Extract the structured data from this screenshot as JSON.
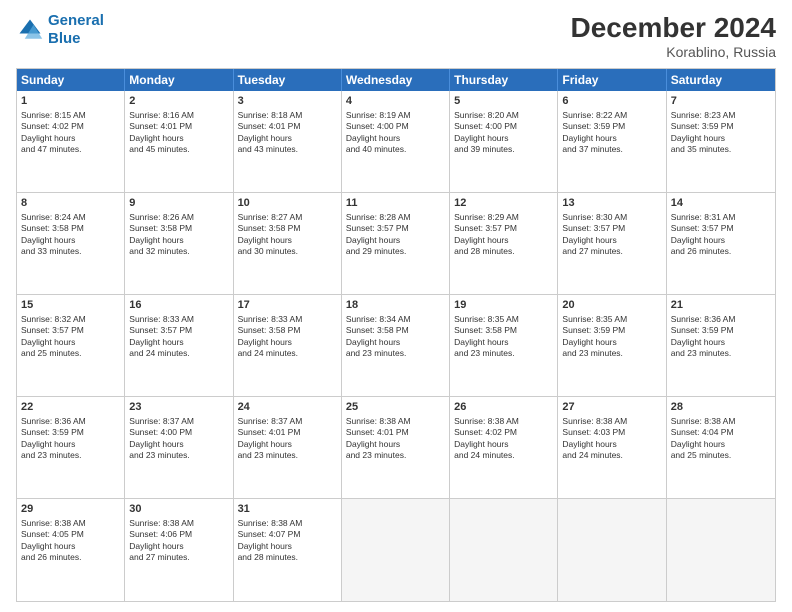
{
  "header": {
    "logo_line1": "General",
    "logo_line2": "Blue",
    "main_title": "December 2024",
    "subtitle": "Korablino, Russia"
  },
  "days": [
    "Sunday",
    "Monday",
    "Tuesday",
    "Wednesday",
    "Thursday",
    "Friday",
    "Saturday"
  ],
  "weeks": [
    [
      {
        "day": "1",
        "sunrise": "8:15 AM",
        "sunset": "4:02 PM",
        "daylight": "7 hours and 47 minutes."
      },
      {
        "day": "2",
        "sunrise": "8:16 AM",
        "sunset": "4:01 PM",
        "daylight": "7 hours and 45 minutes."
      },
      {
        "day": "3",
        "sunrise": "8:18 AM",
        "sunset": "4:01 PM",
        "daylight": "7 hours and 43 minutes."
      },
      {
        "day": "4",
        "sunrise": "8:19 AM",
        "sunset": "4:00 PM",
        "daylight": "7 hours and 40 minutes."
      },
      {
        "day": "5",
        "sunrise": "8:20 AM",
        "sunset": "4:00 PM",
        "daylight": "7 hours and 39 minutes."
      },
      {
        "day": "6",
        "sunrise": "8:22 AM",
        "sunset": "3:59 PM",
        "daylight": "7 hours and 37 minutes."
      },
      {
        "day": "7",
        "sunrise": "8:23 AM",
        "sunset": "3:59 PM",
        "daylight": "7 hours and 35 minutes."
      }
    ],
    [
      {
        "day": "8",
        "sunrise": "8:24 AM",
        "sunset": "3:58 PM",
        "daylight": "7 hours and 33 minutes."
      },
      {
        "day": "9",
        "sunrise": "8:26 AM",
        "sunset": "3:58 PM",
        "daylight": "7 hours and 32 minutes."
      },
      {
        "day": "10",
        "sunrise": "8:27 AM",
        "sunset": "3:58 PM",
        "daylight": "7 hours and 30 minutes."
      },
      {
        "day": "11",
        "sunrise": "8:28 AM",
        "sunset": "3:57 PM",
        "daylight": "7 hours and 29 minutes."
      },
      {
        "day": "12",
        "sunrise": "8:29 AM",
        "sunset": "3:57 PM",
        "daylight": "7 hours and 28 minutes."
      },
      {
        "day": "13",
        "sunrise": "8:30 AM",
        "sunset": "3:57 PM",
        "daylight": "7 hours and 27 minutes."
      },
      {
        "day": "14",
        "sunrise": "8:31 AM",
        "sunset": "3:57 PM",
        "daylight": "7 hours and 26 minutes."
      }
    ],
    [
      {
        "day": "15",
        "sunrise": "8:32 AM",
        "sunset": "3:57 PM",
        "daylight": "7 hours and 25 minutes."
      },
      {
        "day": "16",
        "sunrise": "8:33 AM",
        "sunset": "3:57 PM",
        "daylight": "7 hours and 24 minutes."
      },
      {
        "day": "17",
        "sunrise": "8:33 AM",
        "sunset": "3:58 PM",
        "daylight": "7 hours and 24 minutes."
      },
      {
        "day": "18",
        "sunrise": "8:34 AM",
        "sunset": "3:58 PM",
        "daylight": "7 hours and 23 minutes."
      },
      {
        "day": "19",
        "sunrise": "8:35 AM",
        "sunset": "3:58 PM",
        "daylight": "7 hours and 23 minutes."
      },
      {
        "day": "20",
        "sunrise": "8:35 AM",
        "sunset": "3:59 PM",
        "daylight": "7 hours and 23 minutes."
      },
      {
        "day": "21",
        "sunrise": "8:36 AM",
        "sunset": "3:59 PM",
        "daylight": "7 hours and 23 minutes."
      }
    ],
    [
      {
        "day": "22",
        "sunrise": "8:36 AM",
        "sunset": "3:59 PM",
        "daylight": "7 hours and 23 minutes."
      },
      {
        "day": "23",
        "sunrise": "8:37 AM",
        "sunset": "4:00 PM",
        "daylight": "7 hours and 23 minutes."
      },
      {
        "day": "24",
        "sunrise": "8:37 AM",
        "sunset": "4:01 PM",
        "daylight": "7 hours and 23 minutes."
      },
      {
        "day": "25",
        "sunrise": "8:38 AM",
        "sunset": "4:01 PM",
        "daylight": "7 hours and 23 minutes."
      },
      {
        "day": "26",
        "sunrise": "8:38 AM",
        "sunset": "4:02 PM",
        "daylight": "7 hours and 24 minutes."
      },
      {
        "day": "27",
        "sunrise": "8:38 AM",
        "sunset": "4:03 PM",
        "daylight": "7 hours and 24 minutes."
      },
      {
        "day": "28",
        "sunrise": "8:38 AM",
        "sunset": "4:04 PM",
        "daylight": "7 hours and 25 minutes."
      }
    ],
    [
      {
        "day": "29",
        "sunrise": "8:38 AM",
        "sunset": "4:05 PM",
        "daylight": "7 hours and 26 minutes."
      },
      {
        "day": "30",
        "sunrise": "8:38 AM",
        "sunset": "4:06 PM",
        "daylight": "7 hours and 27 minutes."
      },
      {
        "day": "31",
        "sunrise": "8:38 AM",
        "sunset": "4:07 PM",
        "daylight": "7 hours and 28 minutes."
      },
      null,
      null,
      null,
      null
    ]
  ]
}
